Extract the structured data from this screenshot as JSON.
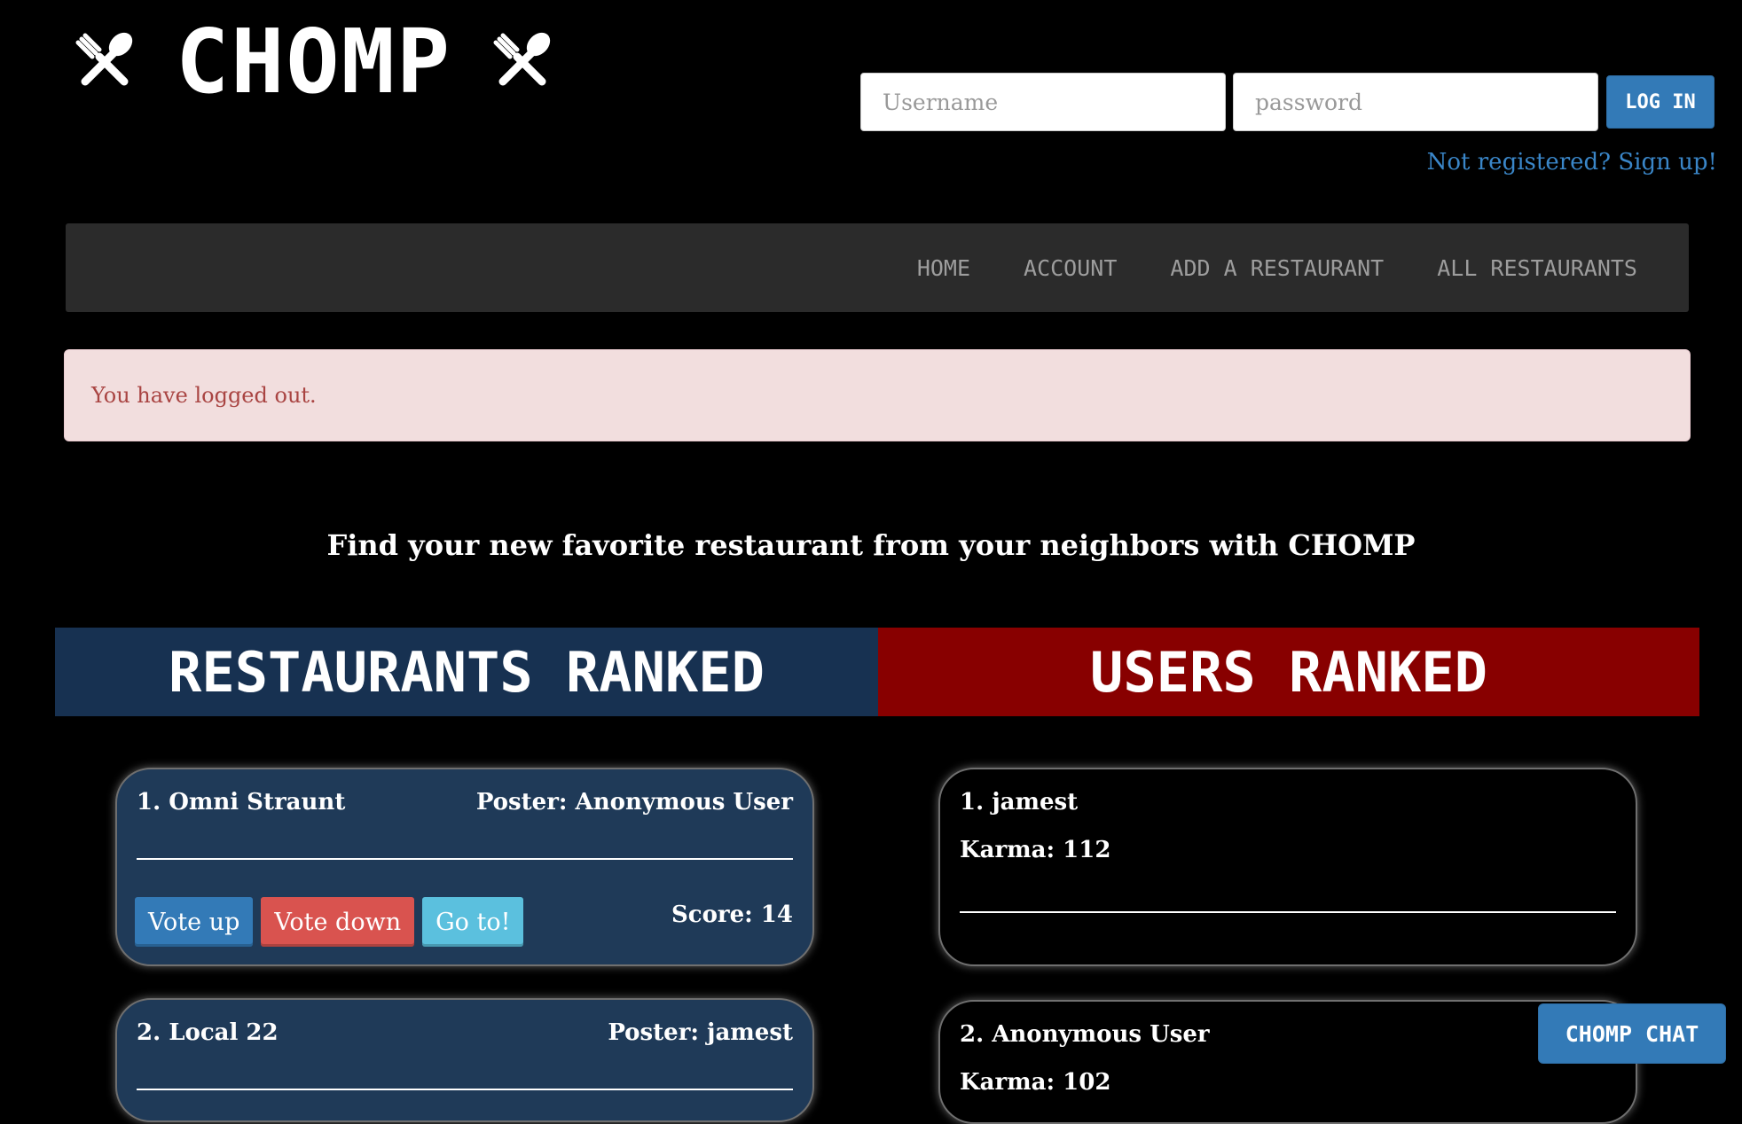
{
  "header": {
    "logo_text": "CHOMP",
    "logo_icon": "fork-spoon-icon"
  },
  "login": {
    "username_placeholder": "Username",
    "password_placeholder": "password",
    "login_button": "LOG IN",
    "signup_link": "Not registered? Sign up!"
  },
  "nav": {
    "items": [
      {
        "label": "HOME"
      },
      {
        "label": "ACCOUNT"
      },
      {
        "label": "ADD A RESTAURANT"
      },
      {
        "label": "ALL RESTAURANTS"
      }
    ]
  },
  "alert": {
    "message": "You have logged out."
  },
  "tagline": "Find your new favorite restaurant from your neighbors with CHOMP",
  "restaurants": {
    "heading": "RESTAURANTS RANKED",
    "items": [
      {
        "title": "1. Omni Straunt",
        "poster": "Poster: Anonymous User",
        "score": "Score: 14"
      },
      {
        "title": "2. Local 22",
        "poster": "Poster: jamest"
      }
    ],
    "vote_up": "Vote up",
    "vote_down": "Vote down",
    "go_to": "Go to!"
  },
  "users": {
    "heading": "USERS RANKED",
    "items": [
      {
        "name": "1. jamest",
        "karma": "Karma: 112"
      },
      {
        "name": "2. Anonymous User",
        "karma": "Karma: 102"
      }
    ]
  },
  "chat_button": "CHOMP CHAT",
  "colors": {
    "background": "#000000",
    "navbar": "#2b2b2b",
    "restaurants_band": "#173151",
    "users_band": "#880000",
    "restaurant_card": "#1f3a58",
    "primary_button": "#337ab7",
    "danger_button": "#d9534f",
    "info_button": "#5bc0de",
    "alert_bg": "#f2dede",
    "alert_text": "#a94442"
  }
}
